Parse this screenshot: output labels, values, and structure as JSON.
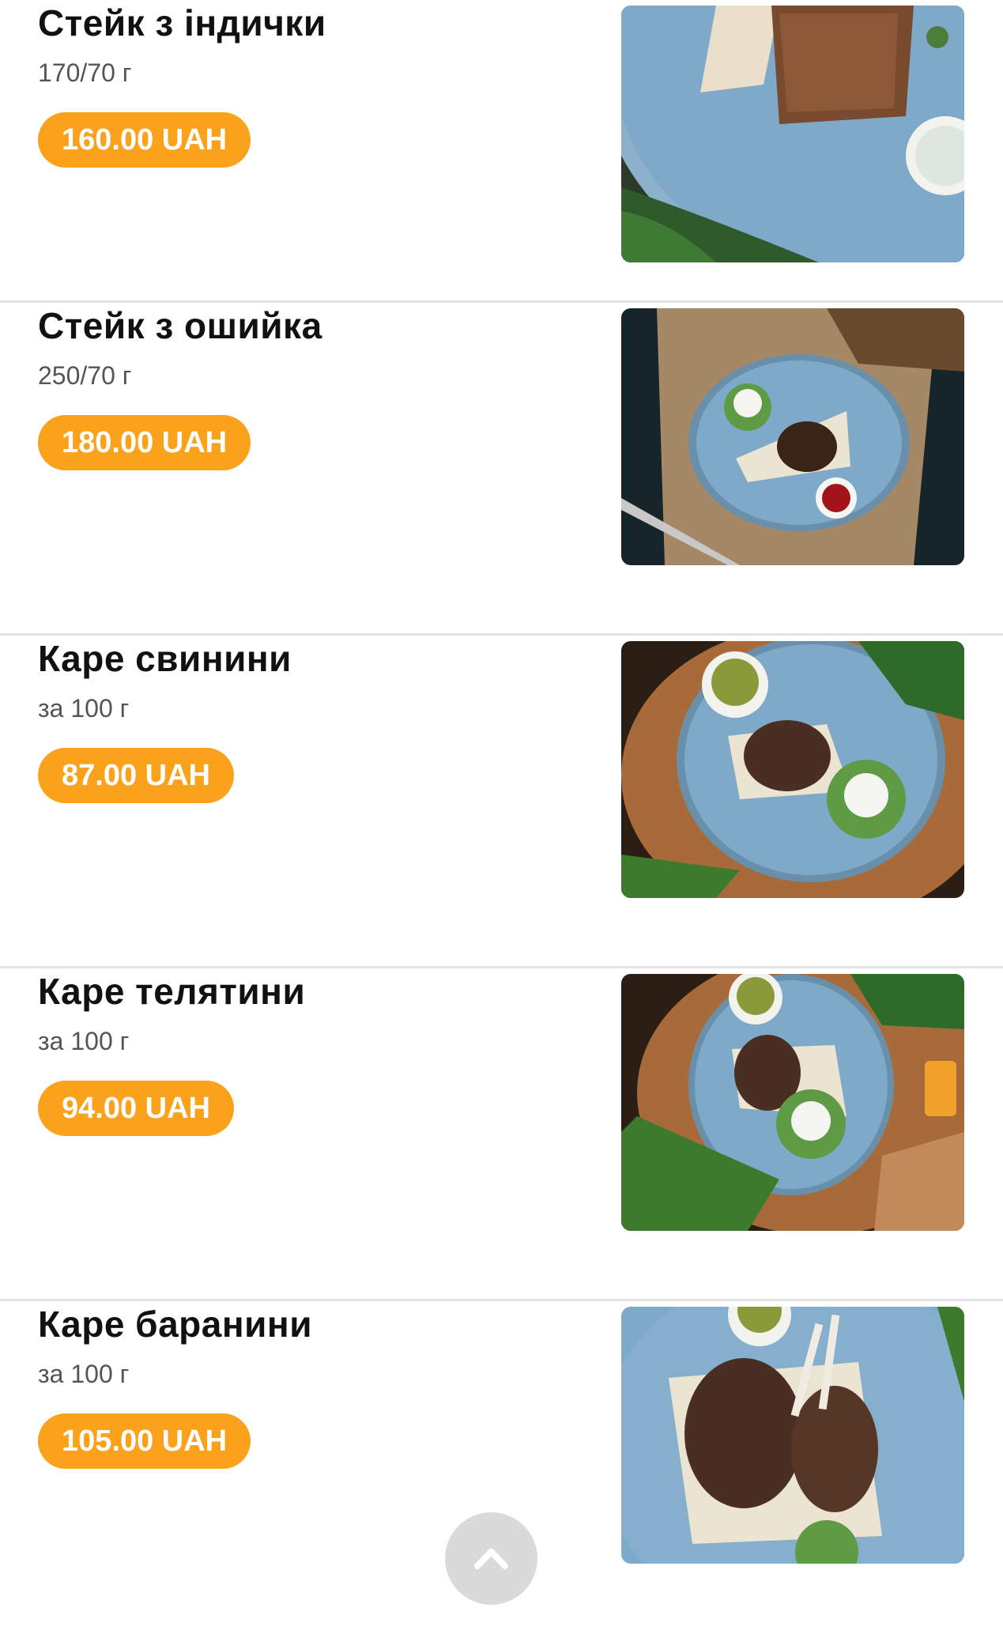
{
  "menu": {
    "items": [
      {
        "name": "Стейк з індички",
        "weight": "170/70 г",
        "price": "160.00 UAH",
        "image": "turkey-steak-photo"
      },
      {
        "name": "Стейк з ошийка",
        "weight": "250/70 г",
        "price": "180.00 UAH",
        "image": "pork-neck-steak-photo"
      },
      {
        "name": "Каре свинини",
        "weight": "за 100 г",
        "price": "87.00 UAH",
        "image": "pork-rack-photo"
      },
      {
        "name": "Каре телятини",
        "weight": "за 100 г",
        "price": "94.00 UAH",
        "image": "veal-rack-photo"
      },
      {
        "name": "Каре баранини",
        "weight": "за 100 г",
        "price": "105.00 UAH",
        "image": "lamb-rack-photo"
      }
    ]
  },
  "scroll_top": {
    "icon": "chevron-up-icon"
  },
  "colors": {
    "price_pill": "#fba21d",
    "price_text": "#ffffff",
    "title_text": "#111111",
    "weight_text": "#555555",
    "divider": "#e3e3e3",
    "plate": "#7fa9c9"
  }
}
